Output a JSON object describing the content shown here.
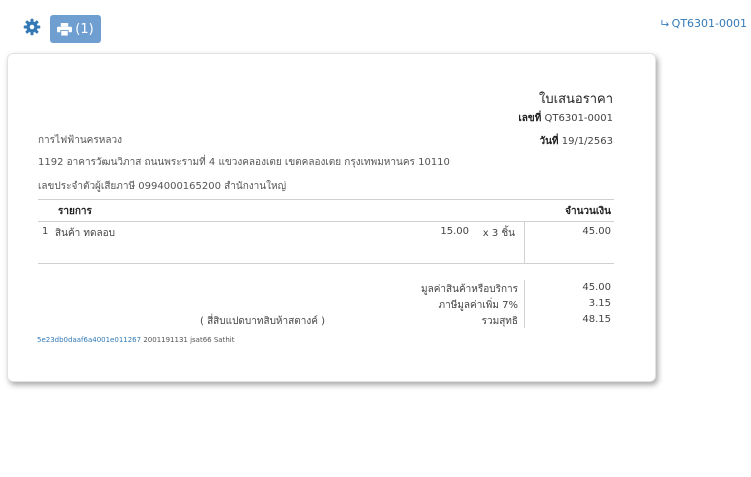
{
  "toolbar": {
    "print_count": "(1)"
  },
  "doc_link": {
    "label": "QT6301-0001"
  },
  "document": {
    "title": "ใบเสนอราคา",
    "number_label": "เลขที่",
    "number": "QT6301-0001",
    "date_label": "วันที่",
    "date": "19/1/2563"
  },
  "customer": {
    "name": "การไฟฟ้านครหลวง",
    "address": "1192 อาคารวัฒนวิภาส ถนนพระรามที่ 4 แขวงคลองเตย เขตคลองเตย กรุงเทพมหานคร 10110",
    "tax_id": "เลขประจำตัวผู้เสียภาษี 0994000165200 สำนักงานใหญ่"
  },
  "table": {
    "headers": {
      "description": "รายการ",
      "amount": "จำนวนเงิน"
    },
    "rows": [
      {
        "no": "1",
        "description": "สินค้า ทดลอบ",
        "price": "15.00",
        "qty": "x 3 ชิ้น",
        "amount": "45.00"
      }
    ]
  },
  "summary": {
    "subtotal_label": "มูลค่าสินค้าหรือบริการ",
    "subtotal": "45.00",
    "vat_label": "ภาษีมูลค่าเพิ่ม  7%",
    "vat": "3.15",
    "total_label": "รวมสุทธิ",
    "total": "48.15",
    "amount_in_words": "( สี่สิบแปดบาทสิบห้าสตางค์ )"
  },
  "footer": {
    "hash": "5e23db0daaf6a4001e011267",
    "text": "2001191131 jsat66 Sathit"
  },
  "colors": {
    "accent": "#337ab7",
    "button": "#6f9fd0"
  }
}
